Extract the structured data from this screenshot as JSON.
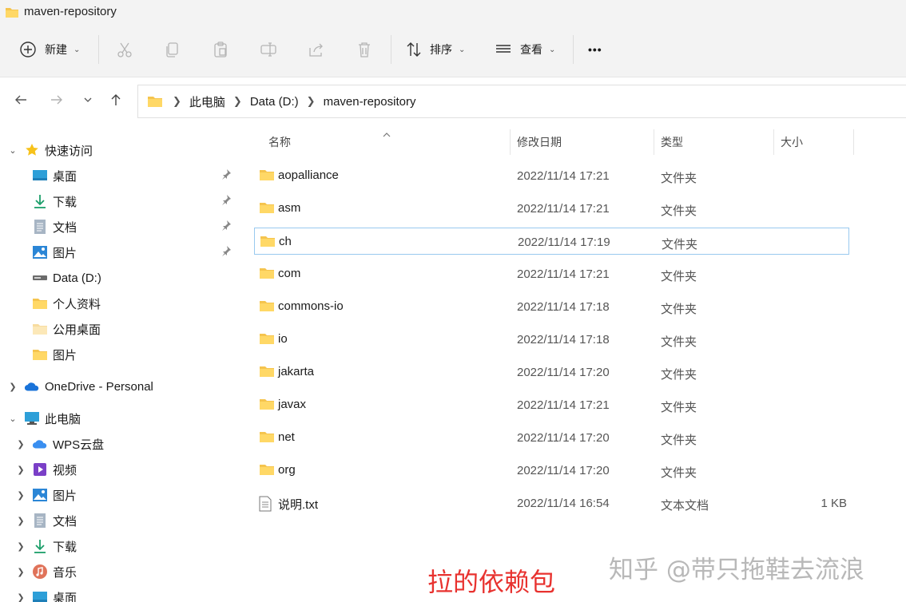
{
  "window": {
    "title": "maven-repository"
  },
  "toolbar": {
    "new_label": "新建",
    "sort_label": "排序",
    "view_label": "查看",
    "more_label": "•••"
  },
  "address": {
    "crumbs": [
      "此电脑",
      "Data (D:)",
      "maven-repository"
    ]
  },
  "sidebar": {
    "quick_access": "快速访问",
    "quick_items": [
      {
        "label": "桌面",
        "icon": "desktop-icon",
        "pinned": true
      },
      {
        "label": "下载",
        "icon": "download-icon",
        "pinned": true
      },
      {
        "label": "文档",
        "icon": "document-icon",
        "pinned": true
      },
      {
        "label": "图片",
        "icon": "picture-icon",
        "pinned": true
      },
      {
        "label": "Data (D:)",
        "icon": "drive-icon",
        "pinned": false
      },
      {
        "label": "个人资料",
        "icon": "folder-icon",
        "pinned": false
      },
      {
        "label": "公用桌面",
        "icon": "folder-icon",
        "pinned": false
      },
      {
        "label": "图片",
        "icon": "folder-icon",
        "pinned": false
      }
    ],
    "onedrive": "OneDrive - Personal",
    "this_pc": "此电脑",
    "pc_items": [
      {
        "label": "WPS云盘",
        "icon": "cloud-icon"
      },
      {
        "label": "视频",
        "icon": "video-icon"
      },
      {
        "label": "图片",
        "icon": "picture-icon"
      },
      {
        "label": "文档",
        "icon": "document-icon"
      },
      {
        "label": "下载",
        "icon": "download-icon"
      },
      {
        "label": "音乐",
        "icon": "music-icon"
      },
      {
        "label": "桌面",
        "icon": "desktop-icon"
      }
    ]
  },
  "columns": {
    "name": "名称",
    "date": "修改日期",
    "type": "类型",
    "size": "大小"
  },
  "files": [
    {
      "name": "aopalliance",
      "date": "2022/11/14 17:21",
      "type": "文件夹",
      "size": "",
      "kind": "folder"
    },
    {
      "name": "asm",
      "date": "2022/11/14 17:21",
      "type": "文件夹",
      "size": "",
      "kind": "folder"
    },
    {
      "name": "ch",
      "date": "2022/11/14 17:19",
      "type": "文件夹",
      "size": "",
      "kind": "folder",
      "selected": true
    },
    {
      "name": "com",
      "date": "2022/11/14 17:21",
      "type": "文件夹",
      "size": "",
      "kind": "folder"
    },
    {
      "name": "commons-io",
      "date": "2022/11/14 17:18",
      "type": "文件夹",
      "size": "",
      "kind": "folder"
    },
    {
      "name": "io",
      "date": "2022/11/14 17:18",
      "type": "文件夹",
      "size": "",
      "kind": "folder"
    },
    {
      "name": "jakarta",
      "date": "2022/11/14 17:20",
      "type": "文件夹",
      "size": "",
      "kind": "folder"
    },
    {
      "name": "javax",
      "date": "2022/11/14 17:21",
      "type": "文件夹",
      "size": "",
      "kind": "folder"
    },
    {
      "name": "net",
      "date": "2022/11/14 17:20",
      "type": "文件夹",
      "size": "",
      "kind": "folder"
    },
    {
      "name": "org",
      "date": "2022/11/14 17:20",
      "type": "文件夹",
      "size": "",
      "kind": "folder"
    },
    {
      "name": "说明.txt",
      "date": "2022/11/14 16:54",
      "type": "文本文档",
      "size": "1 KB",
      "kind": "text"
    }
  ],
  "annotation": "拉的依赖包",
  "watermark": "知乎 @带只拖鞋去流浪",
  "colors": {
    "folder": "#f5c44e",
    "selection_border": "#99c9ef",
    "annotation": "#e8322f"
  }
}
